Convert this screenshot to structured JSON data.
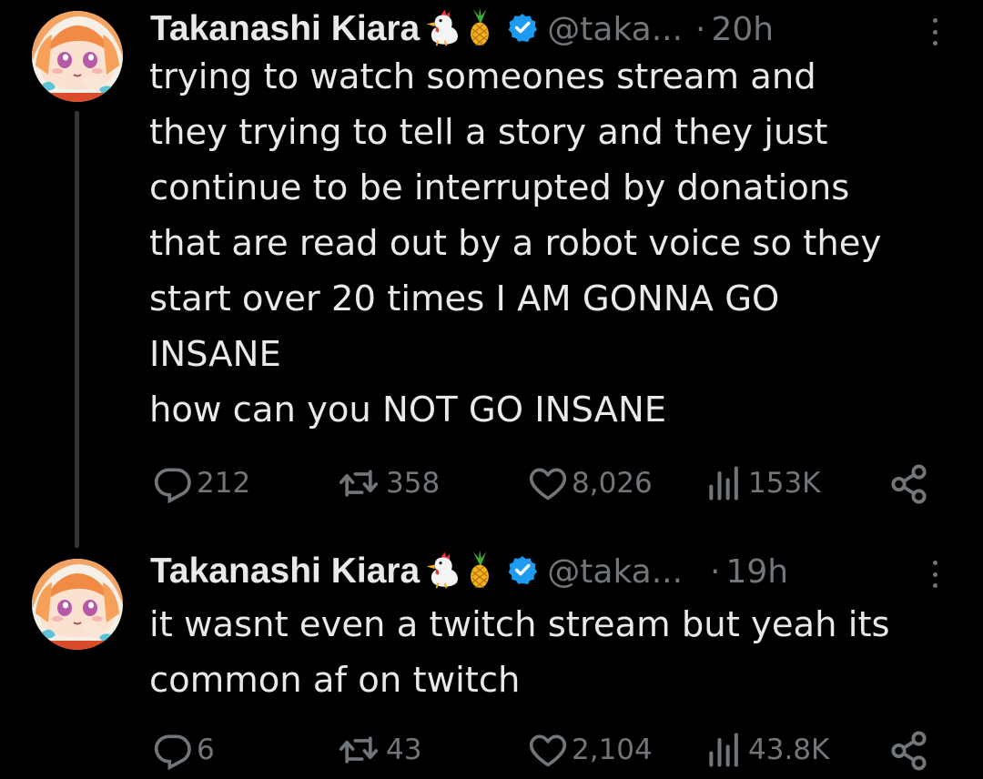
{
  "tweets": [
    {
      "author": "Takanashi Kiara",
      "handle": "@taka...",
      "separator": "·",
      "time": "20h",
      "text_lines": [
        "trying to watch someones stream and",
        "they trying to tell a story and they just",
        "continue to be interrupted by donations",
        "that are read out by a robot voice so they",
        "start over 20 times I AM GONNA GO",
        "INSANE",
        "how can you NOT GO INSANE"
      ],
      "replies": "212",
      "reposts": "358",
      "likes": "8,026",
      "views": "153K"
    },
    {
      "author": "Takanashi Kiara",
      "handle": "@taka...",
      "separator": "·",
      "time": "19h",
      "text_lines": [
        "it wasnt even a twitch stream but yeah its",
        "common af on twitch"
      ],
      "replies": "6",
      "reposts": "43",
      "likes": "2,104",
      "views": "43.8K"
    }
  ],
  "icons": {
    "emoji_1": "chicken-emoji-icon",
    "emoji_2": "pineapple-emoji-icon",
    "verified": "verified-badge-icon",
    "more": "more-options-icon",
    "reply": "reply-icon",
    "repost": "repost-icon",
    "like": "like-icon",
    "views": "views-icon",
    "share": "share-icon"
  },
  "colors": {
    "background": "#000000",
    "text": "#e7e9ea",
    "muted": "#71767b",
    "verified": "#1d9bf0",
    "thread_line": "#333639"
  }
}
